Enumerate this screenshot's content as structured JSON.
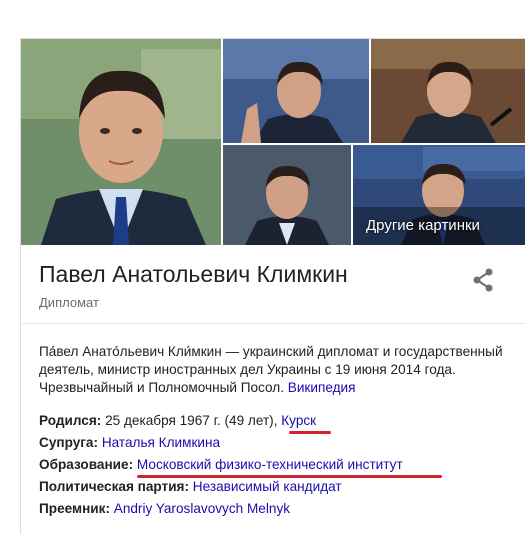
{
  "gallery": {
    "more_images_label": "Другие картинки"
  },
  "entity": {
    "name": "Павел Анатольевич Климкин",
    "subtitle": "Дипломат"
  },
  "description": {
    "text": "Па́вел Анато́льевич Кли́мкин — украинский дипломат и государственный деятель, министр иностранных дел Украины с 19 июня 2014 года. Чрезвычайный и Полномочный Посол. ",
    "source_link": "Википедия"
  },
  "facts": [
    {
      "label": "Родился:",
      "value": "25 декабря 1967 г. (49 лет), ",
      "link": "Курск"
    },
    {
      "label": "Супруга:",
      "value": "",
      "link": "Наталья Климкина"
    },
    {
      "label": "Образование:",
      "value": "",
      "link": "Московский физико-технический институт"
    },
    {
      "label": "Политическая партия:",
      "value": "",
      "link": "Независимый кандидат"
    },
    {
      "label": "Преемник:",
      "value": "",
      "link": "Andriy Yaroslavovych Melnyk"
    }
  ],
  "colors": {
    "link": "#1a0dab",
    "annotation_underline": "#d4202a"
  }
}
